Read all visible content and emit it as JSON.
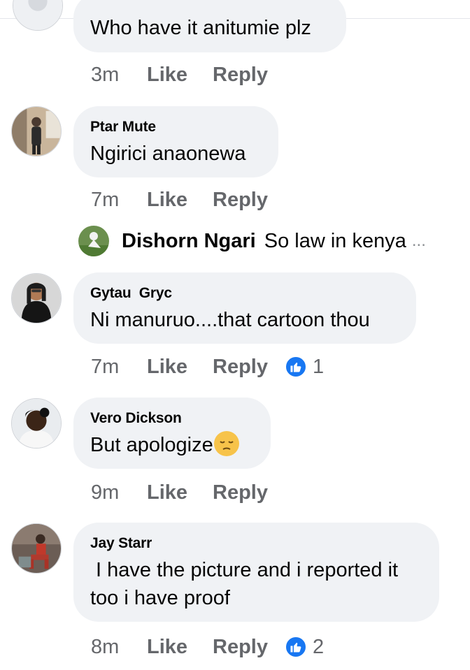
{
  "comments": [
    {
      "author": "",
      "text": "Who have it anitumie plz",
      "time": "3m",
      "like_label": "Like",
      "reply_label": "Reply"
    },
    {
      "author": "Ptar Mute",
      "text": "Ngirici anaonewa",
      "time": "7m",
      "like_label": "Like",
      "reply_label": "Reply"
    },
    {
      "author": "Gytau  Gryc",
      "text": "Ni manuruo....that cartoon thou",
      "time": "7m",
      "like_label": "Like",
      "reply_label": "Reply",
      "reaction_count": "1"
    },
    {
      "author": "Vero Dickson",
      "text": "But apologize",
      "emoji": "pensive-face",
      "time": "9m",
      "like_label": "Like",
      "reply_label": "Reply"
    },
    {
      "author": "Jay Starr",
      "text_line1": " I have the picture and i reported it",
      "text_line2": "too i have proof",
      "time": "8m",
      "like_label": "Like",
      "reply_label": "Reply",
      "reaction_count": "2"
    }
  ],
  "reply_preview": {
    "author": "Dishorn Ngari",
    "text": "So law in kenya",
    "ellipsis": "..."
  },
  "colors": {
    "bubble": "#f0f2f5",
    "meta_text": "#65676b",
    "like_badge": "#1877f2"
  }
}
